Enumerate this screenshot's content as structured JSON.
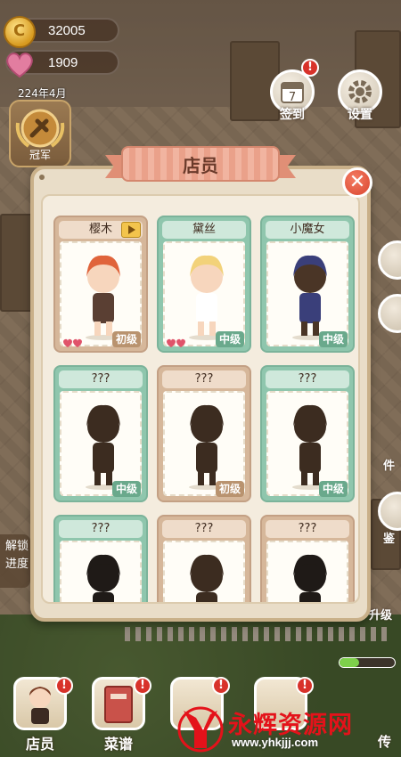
{
  "hud": {
    "coins": "32005",
    "hearts": "1909",
    "date": "224年4月",
    "trophy_label": "冠军",
    "checkin_label": "签到",
    "checkin_day": "7",
    "settings_label": "设置",
    "alert_mark": "!"
  },
  "modal": {
    "title": "店员",
    "close_symbol": "✕"
  },
  "staff": [
    {
      "name": "樱木",
      "level": "初级",
      "color": "tan",
      "has_video": true,
      "hair": "#e0643b",
      "outfit": "#5a3f33",
      "skin": "#f7d6bd",
      "hearts": 2
    },
    {
      "name": "黛丝",
      "level": "中级",
      "color": "green",
      "has_video": false,
      "hair": "#f2d27a",
      "outfit": "#ffffff",
      "skin": "#f7d6bd",
      "hearts": 2
    },
    {
      "name": "小魔女",
      "level": "中级",
      "color": "green",
      "has_video": false,
      "hair": "#3a3f7a",
      "outfit": "#3a3f7a",
      "skin": "#4a3526",
      "hearts": 0
    },
    {
      "name": "???",
      "level": "中级",
      "color": "green",
      "has_video": false,
      "hair": "#3c2c20",
      "outfit": "#3c2c20",
      "skin": "#3c2c20",
      "hearts": 0
    },
    {
      "name": "???",
      "level": "初级",
      "color": "tan",
      "has_video": false,
      "hair": "#3c2c20",
      "outfit": "#3c2c20",
      "skin": "#3c2c20",
      "hearts": 0
    },
    {
      "name": "???",
      "level": "中级",
      "color": "green",
      "has_video": false,
      "hair": "#3c2c20",
      "outfit": "#3c2c20",
      "skin": "#3c2c20",
      "hearts": 0
    },
    {
      "name": "???",
      "level": "",
      "color": "green",
      "has_video": false,
      "hair": "#1f1a17",
      "outfit": "#1f1a17",
      "skin": "#1f1a17",
      "hearts": 0
    },
    {
      "name": "???",
      "level": "",
      "color": "tan",
      "has_video": false,
      "hair": "#3c2c20",
      "outfit": "#3c2c20",
      "skin": "#3c2c20",
      "hearts": 0
    },
    {
      "name": "???",
      "level": "",
      "color": "tan",
      "has_video": false,
      "hair": "#1f1a17",
      "outfit": "#1f1a17",
      "skin": "#1f1a17",
      "hearts": 0
    }
  ],
  "side": {
    "unlock_line1": "解锁",
    "unlock_line2": "进度",
    "right_text_1": "件",
    "right_text_2": "鉴",
    "right_text_3": "升级"
  },
  "bottom": {
    "staff_label": "店员",
    "menu_label": "菜谱",
    "partial_label": "传",
    "progress": 0.35
  },
  "watermark": {
    "title": "永辉资源网",
    "url": "www.yhkjjj.com"
  }
}
